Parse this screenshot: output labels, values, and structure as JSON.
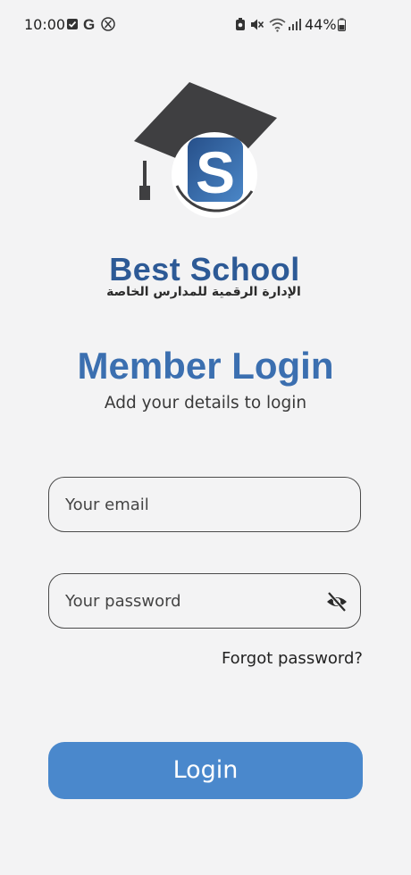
{
  "status_bar": {
    "time": "10:00",
    "battery": "44%",
    "left_icons": [
      "checkbox-icon",
      "google-icon",
      "x-icon"
    ],
    "right_icons": [
      "battery-saver-icon",
      "mute-icon",
      "wifi-icon",
      "signal-icon",
      "battery-icon"
    ]
  },
  "brand": {
    "name": "Best School",
    "tagline": "الإدارة الرقمية للمدارس الخاصة",
    "colors": {
      "primary": "#2d5a96",
      "cap": "#3f3f41"
    }
  },
  "login": {
    "title": "Member Login",
    "subtitle": "Add your details to login",
    "email_placeholder": "Your email",
    "password_placeholder": "Your password",
    "forgot_password": "Forgot password?",
    "submit_label": "Login",
    "accent_color": "#4a88cc",
    "title_color": "#3b6fb0"
  }
}
